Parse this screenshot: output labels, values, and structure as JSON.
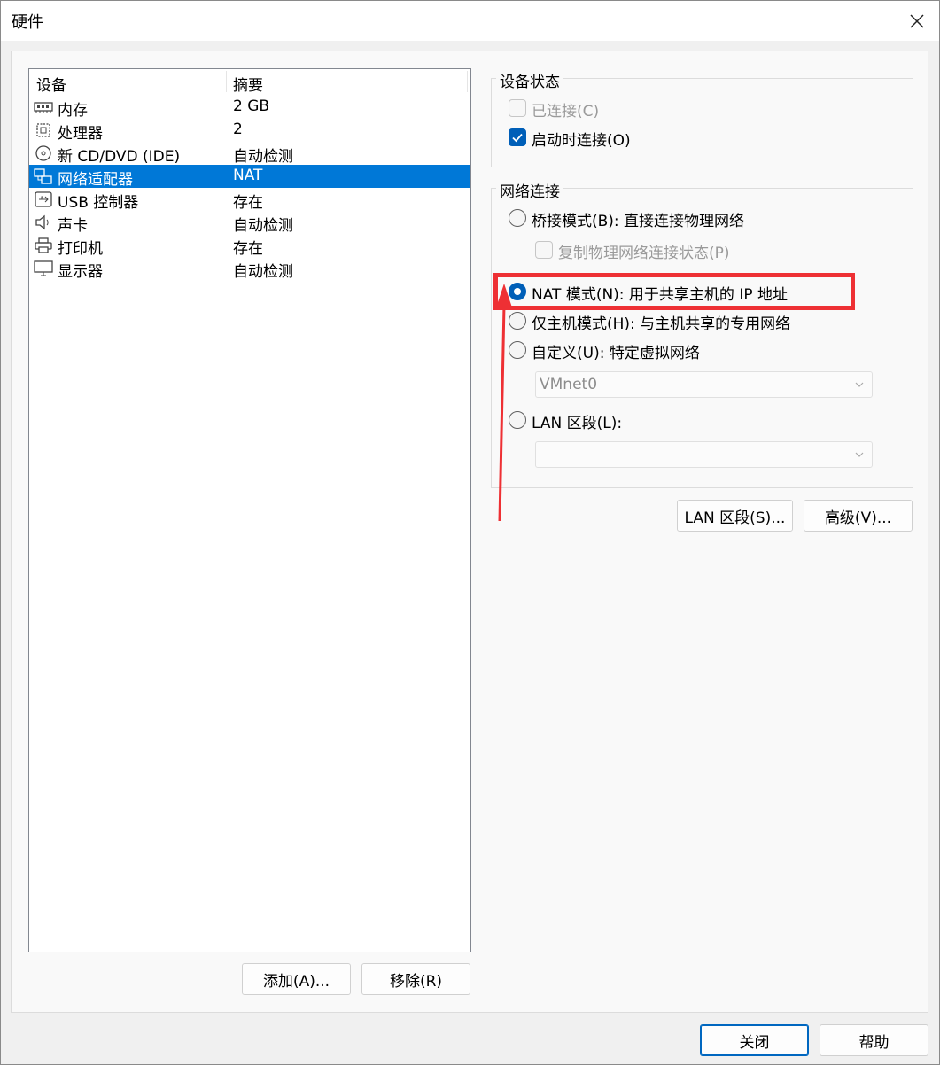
{
  "window": {
    "title": "硬件"
  },
  "device_list": {
    "col_device": "设备",
    "col_summary": "摘要",
    "rows": [
      {
        "name": "内存",
        "summary": "2 GB",
        "icon": "memory-icon"
      },
      {
        "name": "处理器",
        "summary": "2",
        "icon": "processor-icon"
      },
      {
        "name": "新 CD/DVD (IDE)",
        "summary": "自动检测",
        "icon": "cd-dvd-icon"
      },
      {
        "name": "网络适配器",
        "summary": "NAT",
        "icon": "network-adapter-icon",
        "selected": true
      },
      {
        "name": "USB 控制器",
        "summary": "存在",
        "icon": "usb-icon"
      },
      {
        "name": "声卡",
        "summary": "自动检测",
        "icon": "speaker-icon"
      },
      {
        "name": "打印机",
        "summary": "存在",
        "icon": "printer-icon"
      },
      {
        "name": "显示器",
        "summary": "自动检测",
        "icon": "monitor-icon"
      }
    ],
    "add_btn": "添加(A)...",
    "remove_btn": "移除(R)"
  },
  "device_status": {
    "title": "设备状态",
    "connected": "已连接(C)",
    "connect_at_power_on": "启动时连接(O)"
  },
  "network": {
    "title": "网络连接",
    "bridged": "桥接模式(B): 直接连接物理网络",
    "replicate": "复制物理网络连接状态(P)",
    "nat": "NAT 模式(N): 用于共享主机的 IP 地址",
    "host_only": "仅主机模式(H): 与主机共享的专用网络",
    "custom": "自定义(U): 特定虚拟网络",
    "vmnet_value": "VMnet0",
    "lan_segment": "LAN 区段(L):",
    "lan_segment_value": "",
    "lan_seg_btn": "LAN 区段(S)...",
    "advanced_btn": "高级(V)..."
  },
  "footer": {
    "close_btn": "关闭",
    "help_btn": "帮助"
  },
  "colors": {
    "selection": "#0078d7",
    "accent": "#005fb8",
    "annotation": "#ee3034"
  }
}
